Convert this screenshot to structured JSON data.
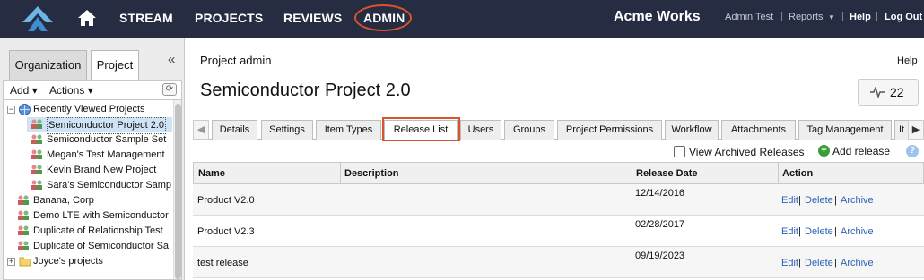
{
  "header": {
    "nav": [
      "STREAM",
      "PROJECTS",
      "REVIEWS",
      "ADMIN"
    ],
    "brand": "Acme Works",
    "user": "Admin Test",
    "reports": "Reports",
    "help": "Help",
    "logout": "Log Out",
    "separator": "|",
    "bg_color": "#262d43",
    "highlight_color": "#d9532b"
  },
  "left_panel": {
    "tabs": [
      "Organization",
      "Project"
    ],
    "add_label": "Add",
    "actions_label": "Actions",
    "tree": [
      {
        "label": "Recently Viewed Projects",
        "icon": "globe-icon"
      },
      {
        "label": "Semiconductor Project 2.0",
        "icon": "project-people-icon"
      },
      {
        "label": "Semiconductor Sample Set",
        "icon": "project-people-icon"
      },
      {
        "label": "Megan's Test Management",
        "icon": "project-people-icon"
      },
      {
        "label": "Kevin Brand New Project",
        "icon": "project-people-icon"
      },
      {
        "label": "Sara's Semiconductor Samp",
        "icon": "project-people-icon"
      },
      {
        "label": "Banana, Corp",
        "icon": "project-people-icon"
      },
      {
        "label": "Demo LTE with Semiconductor",
        "icon": "project-people-icon"
      },
      {
        "label": "Duplicate of Relationship Test",
        "icon": "project-people-icon"
      },
      {
        "label": "Duplicate of Semiconductor Sa",
        "icon": "project-people-icon"
      },
      {
        "label": "Joyce's projects",
        "icon": "folder-icon"
      }
    ]
  },
  "main": {
    "page_title": "Project admin",
    "help": "Help",
    "project_name": "Semiconductor Project 2.0",
    "activity_count": "22",
    "tabs": [
      "Details",
      "Settings",
      "Item Types",
      "Release List",
      "Users",
      "Groups",
      "Project Permissions",
      "Workflow",
      "Attachments",
      "Tag Management",
      "It"
    ],
    "active_tab": "Release List",
    "view_archived": "View Archived Releases",
    "add_release": "Add release",
    "columns": [
      "Name",
      "Description",
      "Release Date",
      "Action"
    ],
    "rows": [
      {
        "name": "Product V2.0",
        "description": "",
        "date": "12/14/2016",
        "actions": [
          "Edit",
          "Delete",
          "Archive"
        ]
      },
      {
        "name": "Product V2.3",
        "description": "",
        "date": "02/28/2017",
        "actions": [
          "Edit",
          "Delete",
          "Archive"
        ]
      },
      {
        "name": "test release",
        "description": "",
        "date": "09/19/2023",
        "actions": [
          "Edit",
          "Delete",
          "Archive"
        ]
      }
    ],
    "link_color": "#2a62b5"
  }
}
